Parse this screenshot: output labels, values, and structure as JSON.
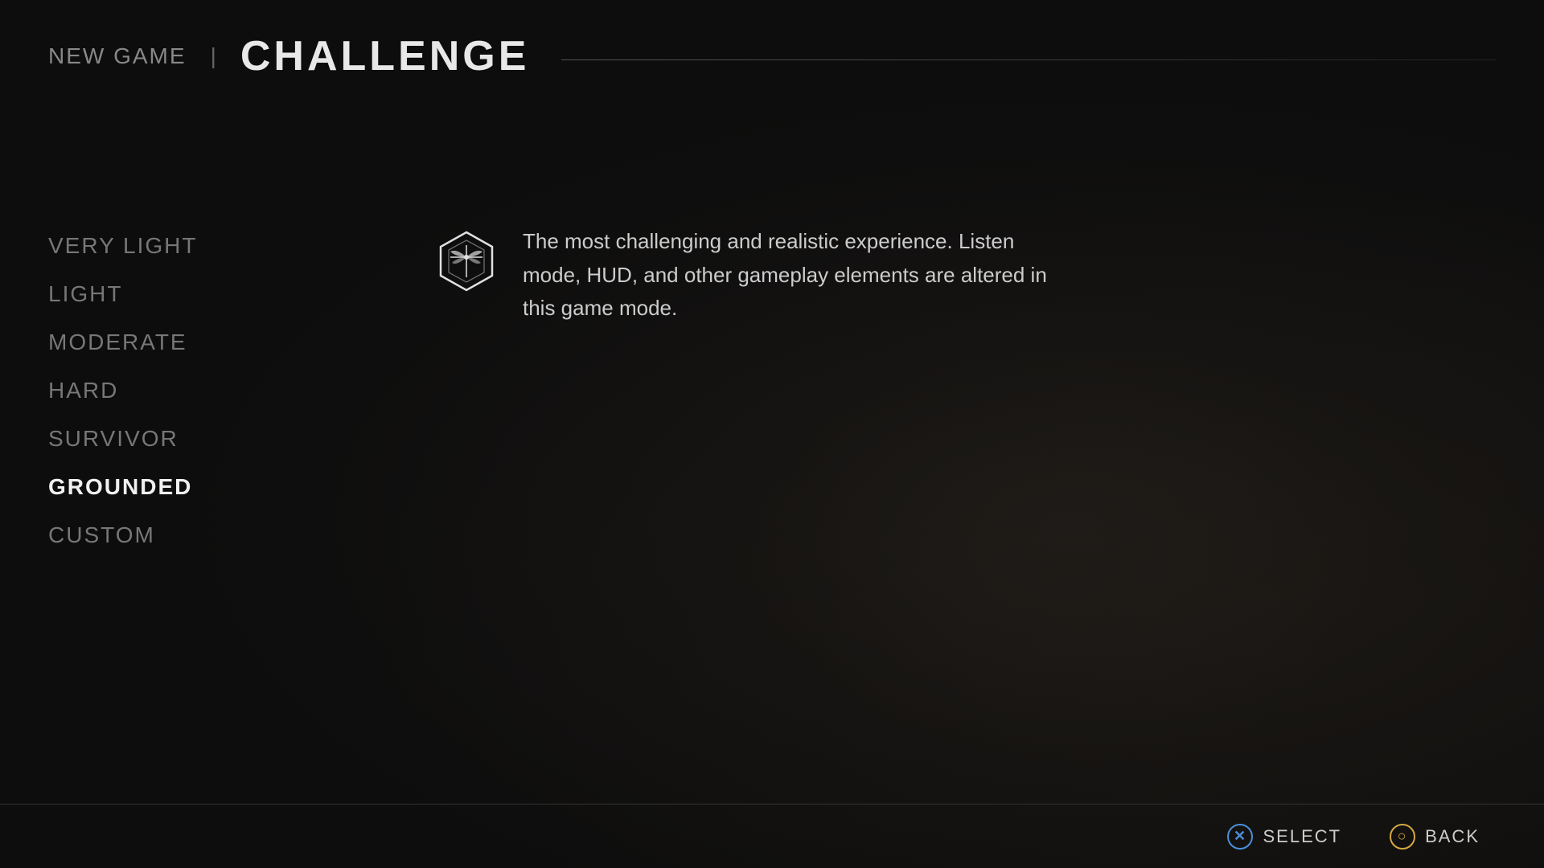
{
  "header": {
    "new_game_label": "NEW GAME",
    "separator": "|",
    "challenge_label": "CHALLENGE"
  },
  "difficulty": {
    "options": [
      {
        "id": "very-light",
        "label": "VERY LIGHT",
        "active": false
      },
      {
        "id": "light",
        "label": "LIGHT",
        "active": false
      },
      {
        "id": "moderate",
        "label": "MODERATE",
        "active": false
      },
      {
        "id": "hard",
        "label": "HARD",
        "active": false
      },
      {
        "id": "survivor",
        "label": "SURVIVOR",
        "active": false
      },
      {
        "id": "grounded",
        "label": "GROUNDED",
        "active": true
      },
      {
        "id": "custom",
        "label": "CUSTOM",
        "active": false
      }
    ]
  },
  "description": {
    "text": "The most challenging and realistic experience. Listen mode, HUD, and other gameplay elements are altered in this game mode."
  },
  "footer": {
    "select_label": "SELECT",
    "back_label": "BACK",
    "select_icon": "✕",
    "back_icon": "○"
  }
}
